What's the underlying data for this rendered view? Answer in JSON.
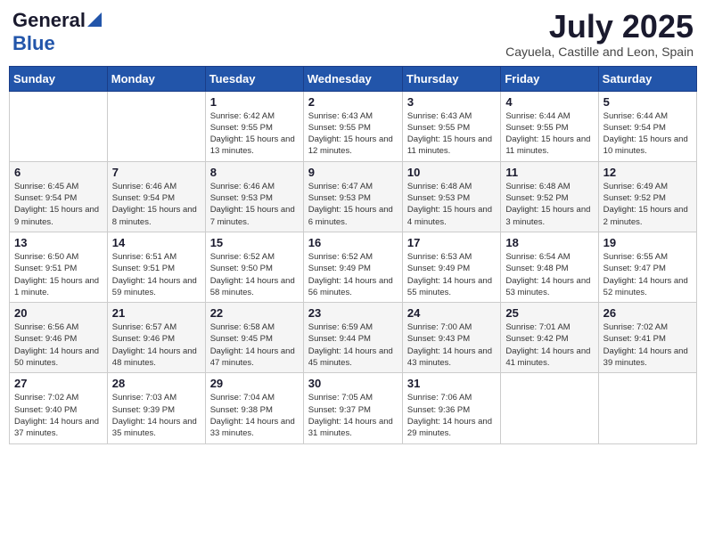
{
  "logo": {
    "general": "General",
    "blue": "Blue"
  },
  "title": "July 2025",
  "location": "Cayuela, Castille and Leon, Spain",
  "weekdays": [
    "Sunday",
    "Monday",
    "Tuesday",
    "Wednesday",
    "Thursday",
    "Friday",
    "Saturday"
  ],
  "weeks": [
    [
      {
        "day": "",
        "sunrise": "",
        "sunset": "",
        "daylight": ""
      },
      {
        "day": "",
        "sunrise": "",
        "sunset": "",
        "daylight": ""
      },
      {
        "day": "1",
        "sunrise": "Sunrise: 6:42 AM",
        "sunset": "Sunset: 9:55 PM",
        "daylight": "Daylight: 15 hours and 13 minutes."
      },
      {
        "day": "2",
        "sunrise": "Sunrise: 6:43 AM",
        "sunset": "Sunset: 9:55 PM",
        "daylight": "Daylight: 15 hours and 12 minutes."
      },
      {
        "day": "3",
        "sunrise": "Sunrise: 6:43 AM",
        "sunset": "Sunset: 9:55 PM",
        "daylight": "Daylight: 15 hours and 11 minutes."
      },
      {
        "day": "4",
        "sunrise": "Sunrise: 6:44 AM",
        "sunset": "Sunset: 9:55 PM",
        "daylight": "Daylight: 15 hours and 11 minutes."
      },
      {
        "day": "5",
        "sunrise": "Sunrise: 6:44 AM",
        "sunset": "Sunset: 9:54 PM",
        "daylight": "Daylight: 15 hours and 10 minutes."
      }
    ],
    [
      {
        "day": "6",
        "sunrise": "Sunrise: 6:45 AM",
        "sunset": "Sunset: 9:54 PM",
        "daylight": "Daylight: 15 hours and 9 minutes."
      },
      {
        "day": "7",
        "sunrise": "Sunrise: 6:46 AM",
        "sunset": "Sunset: 9:54 PM",
        "daylight": "Daylight: 15 hours and 8 minutes."
      },
      {
        "day": "8",
        "sunrise": "Sunrise: 6:46 AM",
        "sunset": "Sunset: 9:53 PM",
        "daylight": "Daylight: 15 hours and 7 minutes."
      },
      {
        "day": "9",
        "sunrise": "Sunrise: 6:47 AM",
        "sunset": "Sunset: 9:53 PM",
        "daylight": "Daylight: 15 hours and 6 minutes."
      },
      {
        "day": "10",
        "sunrise": "Sunrise: 6:48 AM",
        "sunset": "Sunset: 9:53 PM",
        "daylight": "Daylight: 15 hours and 4 minutes."
      },
      {
        "day": "11",
        "sunrise": "Sunrise: 6:48 AM",
        "sunset": "Sunset: 9:52 PM",
        "daylight": "Daylight: 15 hours and 3 minutes."
      },
      {
        "day": "12",
        "sunrise": "Sunrise: 6:49 AM",
        "sunset": "Sunset: 9:52 PM",
        "daylight": "Daylight: 15 hours and 2 minutes."
      }
    ],
    [
      {
        "day": "13",
        "sunrise": "Sunrise: 6:50 AM",
        "sunset": "Sunset: 9:51 PM",
        "daylight": "Daylight: 15 hours and 1 minute."
      },
      {
        "day": "14",
        "sunrise": "Sunrise: 6:51 AM",
        "sunset": "Sunset: 9:51 PM",
        "daylight": "Daylight: 14 hours and 59 minutes."
      },
      {
        "day": "15",
        "sunrise": "Sunrise: 6:52 AM",
        "sunset": "Sunset: 9:50 PM",
        "daylight": "Daylight: 14 hours and 58 minutes."
      },
      {
        "day": "16",
        "sunrise": "Sunrise: 6:52 AM",
        "sunset": "Sunset: 9:49 PM",
        "daylight": "Daylight: 14 hours and 56 minutes."
      },
      {
        "day": "17",
        "sunrise": "Sunrise: 6:53 AM",
        "sunset": "Sunset: 9:49 PM",
        "daylight": "Daylight: 14 hours and 55 minutes."
      },
      {
        "day": "18",
        "sunrise": "Sunrise: 6:54 AM",
        "sunset": "Sunset: 9:48 PM",
        "daylight": "Daylight: 14 hours and 53 minutes."
      },
      {
        "day": "19",
        "sunrise": "Sunrise: 6:55 AM",
        "sunset": "Sunset: 9:47 PM",
        "daylight": "Daylight: 14 hours and 52 minutes."
      }
    ],
    [
      {
        "day": "20",
        "sunrise": "Sunrise: 6:56 AM",
        "sunset": "Sunset: 9:46 PM",
        "daylight": "Daylight: 14 hours and 50 minutes."
      },
      {
        "day": "21",
        "sunrise": "Sunrise: 6:57 AM",
        "sunset": "Sunset: 9:46 PM",
        "daylight": "Daylight: 14 hours and 48 minutes."
      },
      {
        "day": "22",
        "sunrise": "Sunrise: 6:58 AM",
        "sunset": "Sunset: 9:45 PM",
        "daylight": "Daylight: 14 hours and 47 minutes."
      },
      {
        "day": "23",
        "sunrise": "Sunrise: 6:59 AM",
        "sunset": "Sunset: 9:44 PM",
        "daylight": "Daylight: 14 hours and 45 minutes."
      },
      {
        "day": "24",
        "sunrise": "Sunrise: 7:00 AM",
        "sunset": "Sunset: 9:43 PM",
        "daylight": "Daylight: 14 hours and 43 minutes."
      },
      {
        "day": "25",
        "sunrise": "Sunrise: 7:01 AM",
        "sunset": "Sunset: 9:42 PM",
        "daylight": "Daylight: 14 hours and 41 minutes."
      },
      {
        "day": "26",
        "sunrise": "Sunrise: 7:02 AM",
        "sunset": "Sunset: 9:41 PM",
        "daylight": "Daylight: 14 hours and 39 minutes."
      }
    ],
    [
      {
        "day": "27",
        "sunrise": "Sunrise: 7:02 AM",
        "sunset": "Sunset: 9:40 PM",
        "daylight": "Daylight: 14 hours and 37 minutes."
      },
      {
        "day": "28",
        "sunrise": "Sunrise: 7:03 AM",
        "sunset": "Sunset: 9:39 PM",
        "daylight": "Daylight: 14 hours and 35 minutes."
      },
      {
        "day": "29",
        "sunrise": "Sunrise: 7:04 AM",
        "sunset": "Sunset: 9:38 PM",
        "daylight": "Daylight: 14 hours and 33 minutes."
      },
      {
        "day": "30",
        "sunrise": "Sunrise: 7:05 AM",
        "sunset": "Sunset: 9:37 PM",
        "daylight": "Daylight: 14 hours and 31 minutes."
      },
      {
        "day": "31",
        "sunrise": "Sunrise: 7:06 AM",
        "sunset": "Sunset: 9:36 PM",
        "daylight": "Daylight: 14 hours and 29 minutes."
      },
      {
        "day": "",
        "sunrise": "",
        "sunset": "",
        "daylight": ""
      },
      {
        "day": "",
        "sunrise": "",
        "sunset": "",
        "daylight": ""
      }
    ]
  ]
}
